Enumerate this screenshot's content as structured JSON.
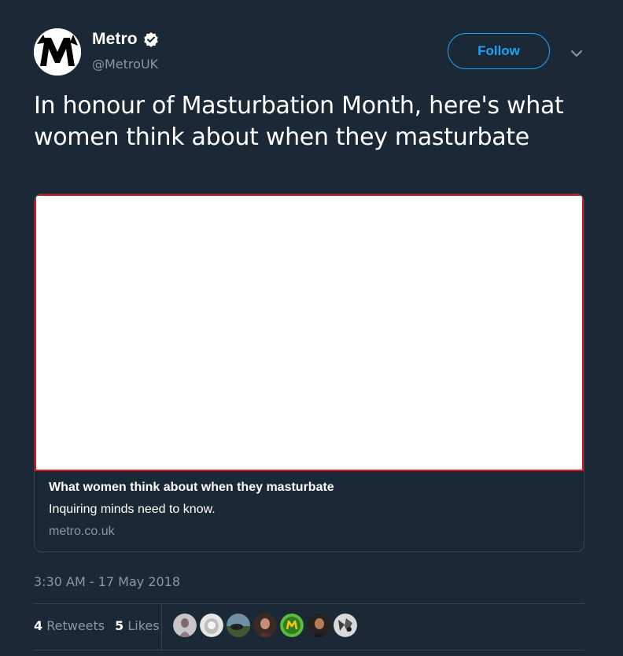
{
  "tweet": {
    "author": {
      "display_name": "Metro",
      "handle": "@MetroUK",
      "verified_icon": "verified-badge-icon",
      "avatar_icon": "metro-logo-icon"
    },
    "follow_label": "Follow",
    "menu_icon": "chevron-down-icon",
    "text": "In honour of Masturbation Month, here's what women think about when they masturbate",
    "card": {
      "title": "What women think about when they masturbate",
      "description": "Inquiring minds need to know.",
      "domain": "metro.co.uk"
    },
    "timestamp": "3:30 AM - 17 May 2018",
    "stats": {
      "retweets_count": "4",
      "retweets_label": "Retweets",
      "likes_count": "5",
      "likes_label": "Likes"
    },
    "liker_avatar_count": 7
  },
  "colors": {
    "background": "#1b2836",
    "accent": "#1da1f2",
    "secondary_text": "#8899a6",
    "divider": "#38444d",
    "card_image_border": "#e0101a"
  }
}
